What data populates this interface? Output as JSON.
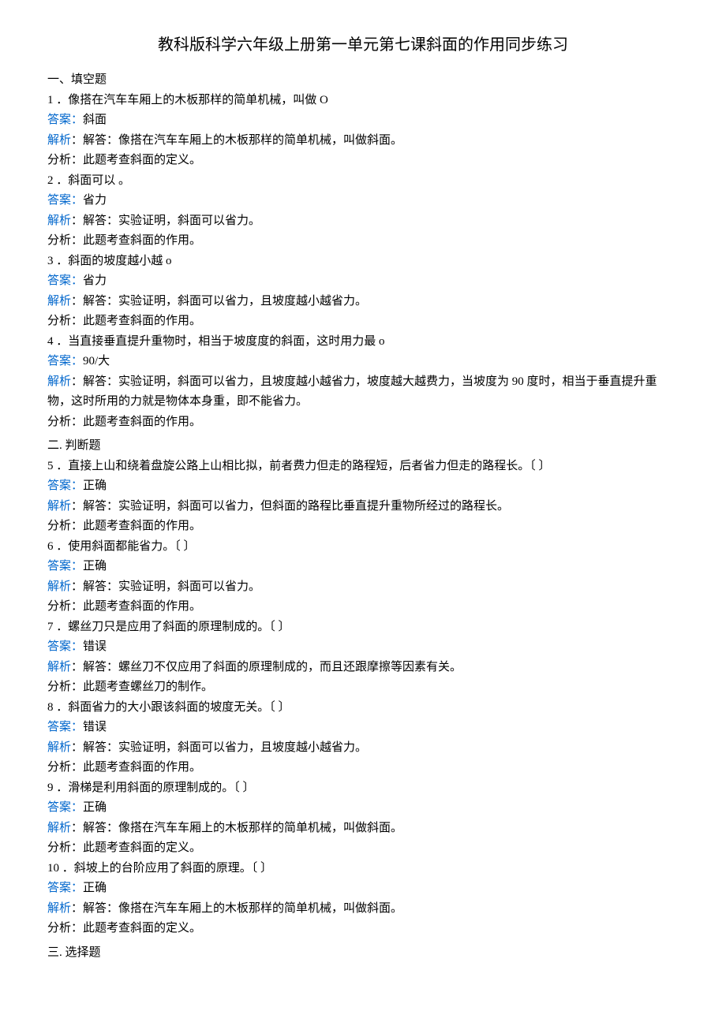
{
  "title": "教科版科学六年级上册第一单元第七课斜面的作用同步练习",
  "section1": {
    "heading": "一、填空题",
    "items": [
      {
        "num": "1",
        "question": "．像搭在汽车车厢上的木板那样的简单机械，叫做 O",
        "answer_label": "答案：",
        "answer": "斜面",
        "analysis_label": "解析",
        "analysis": "：解答：像搭在汽车车厢上的木板那样的简单机械，叫做斜面。",
        "note": "分析：此题考查斜面的定义。"
      },
      {
        "num": "2",
        "question": "．斜面可以 。",
        "answer_label": "答案：",
        "answer": "省力",
        "analysis_label": "解析",
        "analysis": "：解答：实验证明，斜面可以省力。",
        "note": "分析：此题考查斜面的作用。"
      },
      {
        "num": "3",
        "question": "．斜面的坡度越小越 o",
        "answer_label": "答案：",
        "answer": "省力",
        "analysis_label": "解析",
        "analysis": "：解答：实验证明，斜面可以省力，且坡度越小越省力。",
        "note": "分析：此题考查斜面的作用。"
      },
      {
        "num": "4",
        "question": "．当直接垂直提升重物时，相当于坡度度的斜面，这时用力最 o",
        "answer_label": "答案：",
        "answer": "90/大",
        "analysis_label": "解析",
        "analysis": "：解答：实验证明，斜面可以省力，且坡度越小越省力，坡度越大越费力，当坡度为 90 度时，相当于垂直提升重物，这时所用的力就是物体本身重，即不能省力。",
        "note": "分析：此题考查斜面的作用。"
      }
    ]
  },
  "section2": {
    "heading": "二. 判断题",
    "items": [
      {
        "num": "5",
        "question": "．直接上山和绕着盘旋公路上山相比拟，前者费力但走的路程短，后者省力但走的路程长。〔         〕",
        "answer_label": "答案：",
        "answer": "正确",
        "analysis_label": "解析",
        "analysis": "：解答：实验证明，斜面可以省力，但斜面的路程比垂直提升重物所经过的路程长。",
        "note": "分析：此题考查斜面的作用。"
      },
      {
        "num": "6",
        "question": "．使用斜面都能省力。〔   〕",
        "answer_label": "答案：",
        "answer": "正确",
        "analysis_label": "解析",
        "analysis": "：解答：实验证明，斜面可以省力。",
        "note": "分析：此题考查斜面的作用。"
      },
      {
        "num": "7",
        "question": "．螺丝刀只是应用了斜面的原理制成的。〔     〕",
        "answer_label": "答案：",
        "answer": "错误",
        "analysis_label": "解析",
        "analysis": "：解答：螺丝刀不仅应用了斜面的原理制成的，而且还跟摩擦等因素有关。",
        "note": "分析：此题考查螺丝刀的制作。"
      },
      {
        "num": "8",
        "question": "．斜面省力的大小跟该斜面的坡度无关。〔     〕",
        "answer_label": "答案：",
        "answer": "错误",
        "analysis_label": "解析",
        "analysis": "：解答：实验证明，斜面可以省力，且坡度越小越省力。",
        "note": "分析：此题考查斜面的作用。"
      },
      {
        "num": "9",
        "question": "．滑梯是利用斜面的原理制成的。〔      〕",
        "answer_label": "答案：",
        "answer": "正确",
        "analysis_label": "解析",
        "analysis": "：解答：像搭在汽车车厢上的木板那样的简单机械，叫做斜面。",
        "note": "分析：此题考查斜面的定义。"
      },
      {
        "num": "10",
        "question": "．斜坡上的台阶应用了斜面的原理。〔   〕",
        "answer_label": "答案：",
        "answer": "正确",
        "analysis_label": "解析",
        "analysis": "：解答：像搭在汽车车厢上的木板那样的简单机械，叫做斜面。",
        "note": "分析：此题考查斜面的定义。"
      }
    ]
  },
  "section3": {
    "heading": "三. 选择题"
  }
}
